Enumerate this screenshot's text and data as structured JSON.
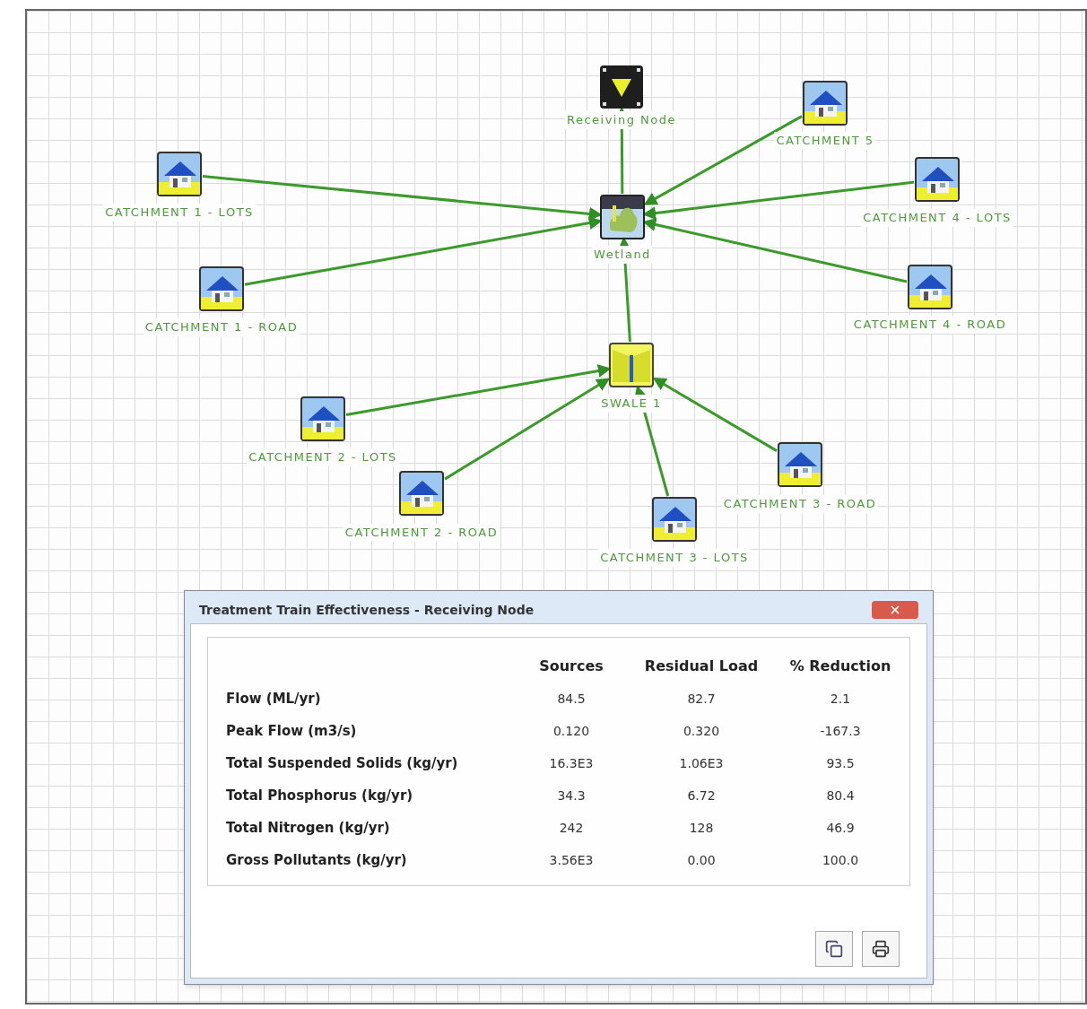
{
  "nodes": [
    {
      "kind": "outlet",
      "label": "Receiving Node"
    },
    {
      "kind": "wetland",
      "label": "Wetland"
    },
    {
      "kind": "swale",
      "label": "SWALE 1"
    },
    {
      "kind": "catchment",
      "label": "CATCHMENT 5"
    },
    {
      "kind": "catchment",
      "label": "CATCHMENT 1 - LOTS"
    },
    {
      "kind": "catchment",
      "label": "CATCHMENT 4 - LOTS"
    },
    {
      "kind": "catchment",
      "label": "CATCHMENT 1 - ROAD"
    },
    {
      "kind": "catchment",
      "label": "CATCHMENT 4 - ROAD"
    },
    {
      "kind": "catchment",
      "label": "CATCHMENT 2 - LOTS"
    },
    {
      "kind": "catchment",
      "label": "CATCHMENT 2 - ROAD"
    },
    {
      "kind": "catchment",
      "label": "CATCHMENT 3 - ROAD"
    },
    {
      "kind": "catchment",
      "label": "CATCHMENT 3 - LOTS"
    }
  ],
  "dialog": {
    "title": "Treatment Train Effectiveness - Receiving Node",
    "columns": [
      "Sources",
      "Residual Load",
      "% Reduction"
    ],
    "rows": [
      {
        "label": "Flow (ML/yr)",
        "values": [
          "84.5",
          "82.7",
          "2.1"
        ]
      },
      {
        "label": "Peak Flow (m3/s)",
        "values": [
          "0.120",
          "0.320",
          "-167.3"
        ]
      },
      {
        "label": "Total Suspended Solids (kg/yr)",
        "values": [
          "16.3E3",
          "1.06E3",
          "93.5"
        ]
      },
      {
        "label": "Total Phosphorus (kg/yr)",
        "values": [
          "34.3",
          "6.72",
          "80.4"
        ]
      },
      {
        "label": "Total Nitrogen (kg/yr)",
        "values": [
          "242",
          "128",
          "46.9"
        ]
      },
      {
        "label": "Gross Pollutants (kg/yr)",
        "values": [
          "3.56E3",
          "0.00",
          "100.0"
        ]
      }
    ]
  }
}
